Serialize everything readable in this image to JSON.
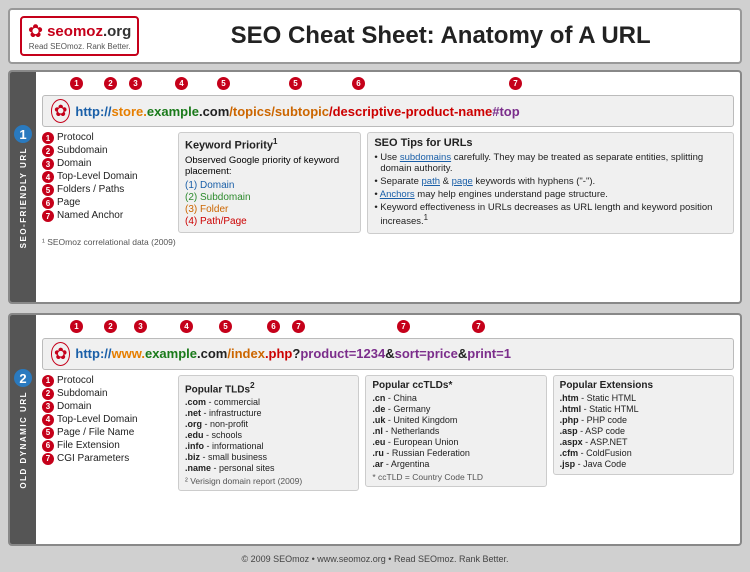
{
  "header": {
    "logo": {
      "name": "seomoz.org",
      "tagline": "Read SEOmoz. Rank Better."
    },
    "title": "SEO Cheat Sheet: Anatomy of A URL"
  },
  "section1": {
    "number": "1",
    "label": "SEO-FRIENDLY URL",
    "url": "http://store.example.com/topics/subtopic/descriptive-product-name#top",
    "url_parts": {
      "protocol": "http://",
      "subdomain": "store.",
      "domain": "example",
      "tld": ".com",
      "folder1": "/topics",
      "folder2": "/subtopic",
      "page": "/descriptive-product-name",
      "anchor": "#top"
    },
    "bubble_positions": [
      {
        "n": "1",
        "label": "Protocol"
      },
      {
        "n": "2",
        "label": "Subdomain"
      },
      {
        "n": "3",
        "label": "Domain"
      },
      {
        "n": "4",
        "label": "Top-Level Domain"
      },
      {
        "n": "5",
        "label": "Folders / Paths"
      },
      {
        "n": "5b",
        "label": ""
      },
      {
        "n": "6",
        "label": "Page"
      },
      {
        "n": "7",
        "label": "Named Anchor"
      }
    ],
    "legend": [
      {
        "num": "1",
        "text": "Protocol"
      },
      {
        "num": "2",
        "text": "Subdomain"
      },
      {
        "num": "3",
        "text": "Domain"
      },
      {
        "num": "4",
        "text": "Top-Level Domain"
      },
      {
        "num": "5",
        "text": "Folders / Paths"
      },
      {
        "num": "6",
        "text": "Page"
      },
      {
        "num": "7",
        "text": "Named Anchor"
      }
    ],
    "keyword_box": {
      "title": "Keyword Priority",
      "footnote": "1",
      "desc": "Observed Google priority of keyword placement:",
      "items": [
        {
          "rank": "(1)",
          "label": "Domain",
          "color": "domain"
        },
        {
          "rank": "(2)",
          "label": "Subdomain",
          "color": "subdomain"
        },
        {
          "rank": "(3)",
          "label": "Folder",
          "color": "folder"
        },
        {
          "rank": "(4)",
          "label": "Path/Page",
          "color": "pathpage"
        }
      ]
    },
    "seo_tips": {
      "title": "SEO Tips for URLs",
      "tips": [
        "Use subdomains carefully. They may be treated as separate entities, splitting domain authority.",
        "Separate path & page keywords with hyphens (\"-\").",
        "Anchors may help engines understand page structure.",
        "Keyword effectiveness in URLs decreases as URL length and keyword position increases.¹"
      ]
    },
    "footnote": "¹ SEOmoz correlational data (2009)"
  },
  "section2": {
    "number": "2",
    "label": "OLD DYNAMIC URL",
    "url": "http://www.example.com/index.php?product=1234&sort=price&print=1",
    "legend": [
      {
        "num": "1",
        "text": "Protocol"
      },
      {
        "num": "2",
        "text": "Subdomain"
      },
      {
        "num": "3",
        "text": "Domain"
      },
      {
        "num": "4",
        "text": "Top-Level Domain"
      },
      {
        "num": "5",
        "text": "Page / File Name"
      },
      {
        "num": "6",
        "text": "File Extension"
      },
      {
        "num": "7",
        "text": "CGI Parameters"
      }
    ],
    "tlds": {
      "title": "Popular TLDs",
      "footnote": "2",
      "items": [
        {
          ".com": "commercial"
        },
        {
          ".net": "infrastructure"
        },
        {
          ".org": "non-profit"
        },
        {
          ".edu": "schools"
        },
        {
          ".info": "informational"
        },
        {
          ".biz": "small business"
        },
        {
          ".name": "personal sites"
        }
      ],
      "footnote_text": "² Verisign domain report (2009)"
    },
    "cctlds": {
      "title": "Popular ccTLDs*",
      "items": [
        {
          ".cn": "China"
        },
        {
          ".de": "Germany"
        },
        {
          ".uk": "United Kingdom"
        },
        {
          ".nl": "Netherlands"
        },
        {
          ".eu": "European Union"
        },
        {
          ".ru": "Russian Federation"
        },
        {
          ".ar": "Argentina"
        }
      ],
      "footnote_text": "* ccTLD = Country Code TLD"
    },
    "extensions": {
      "title": "Popular Extensions",
      "items": [
        {
          ".htm": "Static HTML"
        },
        {
          ".html": "Static HTML"
        },
        {
          ".php": "PHP code"
        },
        {
          ".asp": "ASP code"
        },
        {
          ".aspx": "ASP.NET"
        },
        {
          ".cfm": "ColdFusion"
        },
        {
          ".jsp": "Java Code"
        }
      ]
    }
  },
  "footer": {
    "text": "© 2009 SEOmoz • www.seomoz.org • Read SEOmoz. Rank Better."
  }
}
